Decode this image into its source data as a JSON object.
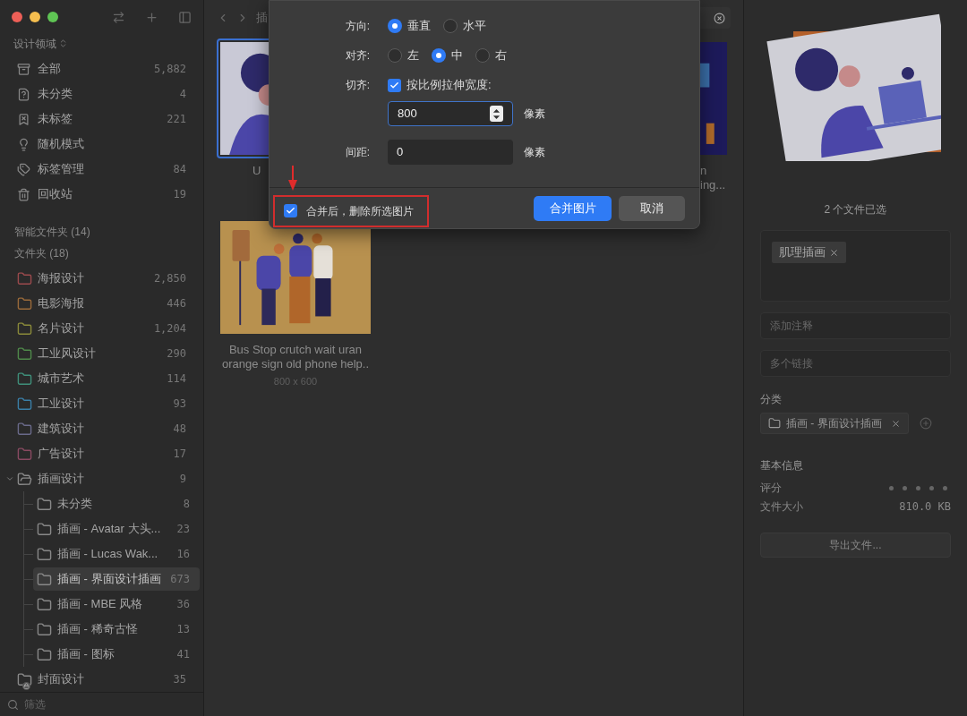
{
  "sidebar": {
    "library": "设计领域",
    "nav": [
      {
        "kind": "all",
        "label": "全部",
        "count": "5,882"
      },
      {
        "kind": "uncategorized",
        "label": "未分类",
        "count": "4"
      },
      {
        "kind": "untagged",
        "label": "未标签",
        "count": "221"
      },
      {
        "kind": "random",
        "label": "随机模式"
      },
      {
        "kind": "tags",
        "label": "标签管理",
        "count": "84"
      },
      {
        "kind": "trash",
        "label": "回收站",
        "count": "19"
      }
    ],
    "smart_folders": "智能文件夹 (14)",
    "folders_header": "文件夹 (18)",
    "folders": [
      {
        "label": "海报设计",
        "count": "2,850",
        "color": "#9b4a4d",
        "selected": false,
        "locked": false
      },
      {
        "label": "电影海报",
        "count": "446",
        "color": "#9a6a3a",
        "selected": false,
        "locked": false
      },
      {
        "label": "名片设计",
        "count": "1,204",
        "color": "#8a8a3a",
        "selected": false,
        "locked": false
      },
      {
        "label": "工业风设计",
        "count": "290",
        "color": "#4f8a4a",
        "selected": false,
        "locked": false
      },
      {
        "label": "城市艺术",
        "count": "114",
        "color": "#3f8f7a",
        "selected": false,
        "locked": false
      },
      {
        "label": "工业设计",
        "count": "93",
        "color": "#3a7fa8",
        "selected": false,
        "locked": false
      },
      {
        "label": "建筑设计",
        "count": "48",
        "color": "#6a6a8a",
        "selected": false,
        "locked": false
      },
      {
        "label": "广告设计",
        "count": "17",
        "color": "#8a4a62",
        "selected": false,
        "locked": false
      },
      {
        "label": "插画设计",
        "count": "9",
        "color": "#8a8a8a",
        "selected": false,
        "locked": false,
        "expanded": true,
        "children": [
          {
            "label": "未分类",
            "count": "8",
            "selected": false
          },
          {
            "label": "插画 - Avatar 大头...",
            "count": "23",
            "selected": false
          },
          {
            "label": "插画 - Lucas Wak...",
            "count": "16",
            "selected": false
          },
          {
            "label": "插画 - 界面设计插画",
            "count": "673",
            "selected": true
          },
          {
            "label": "插画 - MBE 风格",
            "count": "36",
            "selected": false
          },
          {
            "label": "插画 - 稀奇古怪",
            "count": "13",
            "selected": false
          },
          {
            "label": "插画 - 图标",
            "count": "41",
            "selected": false
          }
        ]
      },
      {
        "label": "封面设计",
        "count": "35",
        "color": "#8a8a8a",
        "selected": false,
        "locked": true
      }
    ],
    "filter": {
      "placeholder": "筛选"
    }
  },
  "main": {
    "breadcrumb": "插",
    "cards": [
      {
        "kind": "portrait",
        "selected": true,
        "caption_lines": [
          "U"
        ]
      },
      {
        "kind": "night",
        "selected": false,
        "caption_lines": [
          "n",
          "ing..."
        ]
      },
      {
        "kind": "busstop",
        "selected": false,
        "caption_lines": [
          "Bus Stop crutch wait uran",
          "orange sign old phone help.."
        ],
        "size": "800 x 600"
      }
    ]
  },
  "dialog": {
    "direction": {
      "label": "方向:",
      "options": [
        {
          "label": "垂直",
          "selected": true
        },
        {
          "label": "水平",
          "selected": false
        }
      ]
    },
    "align": {
      "label": "对齐:",
      "options": [
        {
          "label": "左",
          "selected": false
        },
        {
          "label": "中",
          "selected": true
        },
        {
          "label": "右",
          "selected": false
        }
      ]
    },
    "fit": {
      "label": "切齐:",
      "checkbox": {
        "label": "按比例拉伸宽度:",
        "checked": true
      },
      "value": "800",
      "unit": "像素"
    },
    "spacing": {
      "label": "间距:",
      "value": "0",
      "unit": "像素"
    },
    "delete_after": {
      "label": "合并后，删除所选图片",
      "checked": true
    },
    "buttons": [
      {
        "kind": "primary",
        "label": "合并图片"
      },
      {
        "kind": "secondary",
        "label": "取消"
      }
    ]
  },
  "inspector": {
    "selection": "2 个文件已选",
    "tags": [
      "肌理插画"
    ],
    "note": {
      "placeholder": "添加注释"
    },
    "links": {
      "placeholder": "多个链接"
    },
    "category_header": "分类",
    "categories": [
      "插画 - 界面设计插画"
    ],
    "info_header": "基本信息",
    "rating": {
      "label": "评分",
      "stars": 0
    },
    "file_size": {
      "label": "文件大小",
      "value": "810.0 KB"
    },
    "export_button": "导出文件..."
  }
}
